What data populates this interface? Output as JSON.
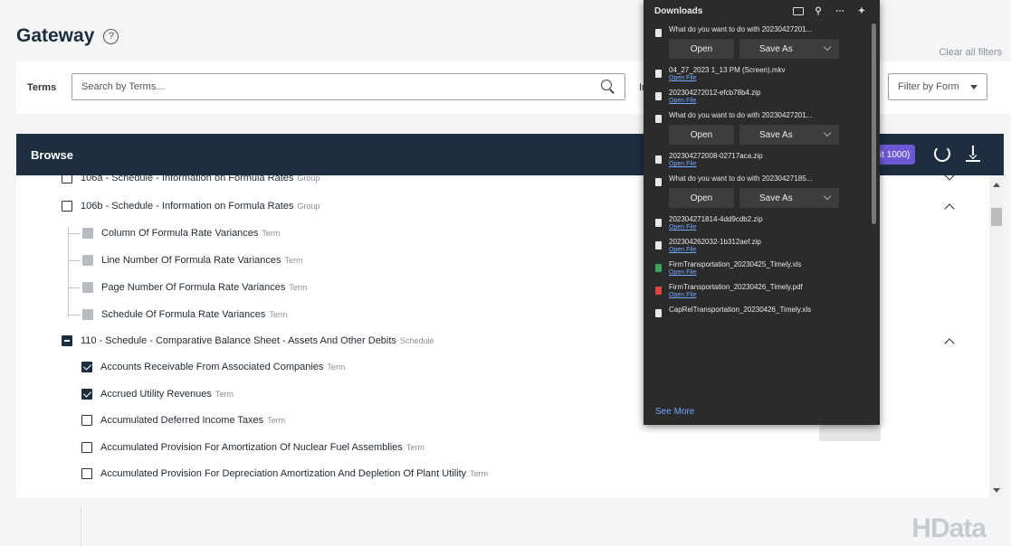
{
  "header": {
    "title": "Gateway",
    "help_icon": "question-circle-icon",
    "clear_filters": "Clear all filters"
  },
  "filters": {
    "terms_label": "Terms",
    "search_placeholder": "Search by Terms...",
    "in_label": "In",
    "form_select": "Filter by Form"
  },
  "browse": {
    "title": "Browse",
    "limit_badge": "it 1000)",
    "rows": [
      {
        "label": "106a - Schedule - Information on Formula Rates",
        "tag": "Group"
      },
      {
        "label": "106b - Schedule - Information on Formula Rates",
        "tag": "Group"
      },
      {
        "label": "Column Of Formula Rate Variances",
        "tag": "Term"
      },
      {
        "label": "Line Number Of Formula Rate Variances",
        "tag": "Term"
      },
      {
        "label": "Page Number Of Formula Rate Variances",
        "tag": "Term"
      },
      {
        "label": "Schedule Of Formula Rate Variances",
        "tag": "Term"
      },
      {
        "label": "110 - Schedule - Comparative Balance Sheet - Assets And Other Debits",
        "tag": "Schedule"
      },
      {
        "label": "Accounts Receivable From Associated Companies",
        "tag": "Term"
      },
      {
        "label": "Accrued Utility Revenues",
        "tag": "Term"
      },
      {
        "label": "Accumulated Deferred Income Taxes",
        "tag": "Term"
      },
      {
        "label": "Accumulated Provision For Amortization Of Nuclear Fuel Assemblies",
        "tag": "Term"
      },
      {
        "label": "Accumulated Provision For Depreciation Amortization And Depletion Of Plant Utility",
        "tag": "Term"
      }
    ]
  },
  "downloads": {
    "title": "Downloads",
    "see_more": "See More",
    "open_label": "Open",
    "save_as_label": "Save As",
    "open_file_label": "Open File",
    "items": [
      {
        "name": "What do you want to do with 20230427201..."
      },
      {
        "name": "04_27_2023 1_13 PM (Screen).mkv"
      },
      {
        "name": "20230427201​2-efcb78b4.zip"
      },
      {
        "name": "What do you want to do with 20230427201..."
      },
      {
        "name": "20230427200​8-02717aca.zip"
      },
      {
        "name": "What do you want to do with 20230427185..."
      },
      {
        "name": "20230427181​4-4dd9cdb2.zip"
      },
      {
        "name": "20230426203​2-1b312aef.zip"
      },
      {
        "name": "FirmTransportation_20230425_Timely.xls"
      },
      {
        "name": "FirmTransportation_20230426_Timely.pdf"
      },
      {
        "name": "CapRelTransportation_20230426_Timely.xls"
      }
    ]
  },
  "footer": {
    "logo": "HData"
  }
}
